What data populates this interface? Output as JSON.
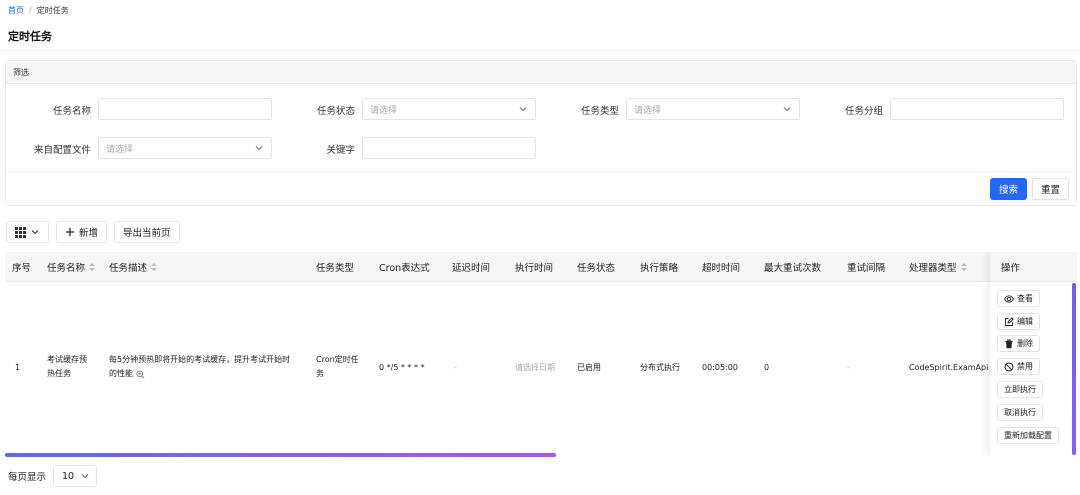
{
  "breadcrumb": {
    "home": "首页",
    "separator": "/",
    "current": "定时任务"
  },
  "page": {
    "title": "定时任务"
  },
  "filter": {
    "header": "筛选",
    "fields": {
      "task_name": {
        "label": "任务名称",
        "value": ""
      },
      "task_status": {
        "label": "任务状态",
        "placeholder": "请选择"
      },
      "task_type": {
        "label": "任务类型",
        "placeholder": "请选择"
      },
      "task_group": {
        "label": "任务分组",
        "value": ""
      },
      "from_config": {
        "label": "来自配置文件",
        "placeholder": "请选择"
      },
      "keyword": {
        "label": "关键字",
        "value": ""
      }
    },
    "search_label": "搜索",
    "reset_label": "重置"
  },
  "toolbar": {
    "add_label": "新增",
    "export_label": "导出当前页"
  },
  "table": {
    "headers": {
      "index": "序号",
      "name": "任务名称",
      "desc": "任务描述",
      "type": "任务类型",
      "cron": "Cron表达式",
      "delay": "延迟时间",
      "exec_time": "执行时间",
      "status": "任务状态",
      "strategy": "执行策略",
      "timeout": "超时时间",
      "max_retry": "最大重试次数",
      "retry_interval": "重试间隔",
      "handler": "处理器类型",
      "ops": "操作"
    },
    "rows": [
      {
        "index": "1",
        "name_l1": "考试缓存预",
        "name_l2": "热任务",
        "desc_l1": "每5分钟预热即将开始的考试缓存，提升考试开始时",
        "desc_l2": "的性能",
        "type_l1": "Cron定时任",
        "type_l2": "务",
        "cron": "0 */5 * * * *",
        "delay": "-",
        "exec_time": "请选择日期",
        "status": "已启用",
        "strategy": "分布式执行",
        "timeout": "00:05:00",
        "max_retry": "0",
        "retry_interval": "-",
        "handler": "CodeSpirit.ExamApi.Ta"
      }
    ],
    "actions": {
      "view": "查看",
      "edit": "编辑",
      "delete": "删除",
      "disable": "禁用",
      "run_now": "立即执行",
      "cancel_run": "取消执行",
      "reload_config": "重新加载配置"
    }
  },
  "pagination": {
    "label": "每页显示",
    "page_size": "10"
  },
  "colors": {
    "primary": "#2468f2",
    "scroll_start": "#6366f1",
    "scroll_end": "#a855f7"
  }
}
